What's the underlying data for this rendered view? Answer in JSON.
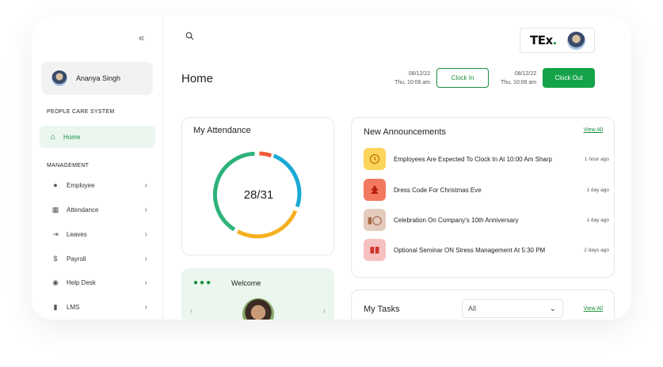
{
  "sidebar": {
    "profile_name": "Ananya Singh",
    "section1": "PEOPLE CARE SYSTEM",
    "home_label": "Home",
    "section2": "MANAGEMENT",
    "items": [
      {
        "label": "Employee",
        "icon": "person-icon"
      },
      {
        "label": "Attendance",
        "icon": "calendar-icon"
      },
      {
        "label": "Leaves",
        "icon": "exit-icon"
      },
      {
        "label": "Payroll",
        "icon": "dollar-icon"
      },
      {
        "label": "Help Desk",
        "icon": "chat-icon"
      },
      {
        "label": "LMS",
        "icon": "book-icon"
      }
    ]
  },
  "header": {
    "brand_text": "TEx",
    "brand_dot": ".",
    "page_title": "Home",
    "clock_in": {
      "date": "08/12/22",
      "time": "Thu, 10:06 am",
      "label": "Clock In"
    },
    "clock_out": {
      "date": "08/12/22",
      "time": "Thu, 10:06 am",
      "label": "Clock Out"
    }
  },
  "attendance": {
    "title": "My Attendance",
    "value_label": "28/31",
    "present": 28,
    "total": 31,
    "colors": {
      "green": "#2db37a",
      "blue": "#19a9d4",
      "orange": "#f5b020",
      "red": "#ef5a3a"
    }
  },
  "welcome": {
    "dots": "●●●",
    "title": "Welcome"
  },
  "announcements": {
    "title": "New Announcements",
    "view_all": "View All",
    "items": [
      {
        "text": "Employees Are Expected To Clock In At 10:00 Am Sharp",
        "time": "1 hour ago",
        "icon": "clock-icon",
        "bg": "#fbd45c",
        "fg": "#c07a00"
      },
      {
        "text": "Dress Code For Christmas Eve",
        "time": "1 day ago",
        "icon": "tree-icon",
        "bg": "#f2795f",
        "fg": "#b81f0f"
      },
      {
        "text": "Celebration On Company's 10th Anniversary",
        "time": "1 day ago",
        "icon": "anniversary-icon",
        "bg": "#e3cbbd",
        "fg": "#a56a4a"
      },
      {
        "text": "Optional Seminar ON Stress Management At 5:30 PM",
        "time": "2 days ago",
        "icon": "book-open-icon",
        "bg": "#f6c1c1",
        "fg": "#d0342c"
      }
    ]
  },
  "tasks": {
    "title": "My Tasks",
    "filter_value": "All",
    "view_all": "View All"
  }
}
